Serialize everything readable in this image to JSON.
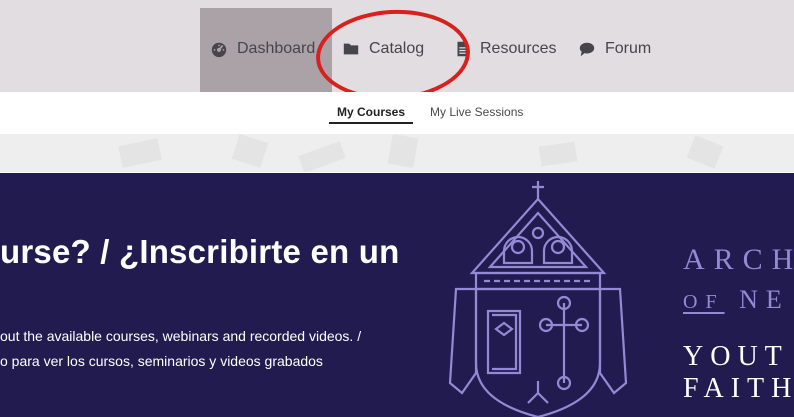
{
  "nav": {
    "items": [
      {
        "label": "Dashboard",
        "icon": "dashboard-gauge-icon",
        "active": true
      },
      {
        "label": "Catalog",
        "icon": "folder-icon",
        "active": false
      },
      {
        "label": "Resources",
        "icon": "document-icon",
        "active": false
      },
      {
        "label": "Forum",
        "icon": "speech-bubble-icon",
        "active": false
      }
    ],
    "annotation_color": "#d8211c"
  },
  "subtabs": {
    "items": [
      {
        "label": "My Courses",
        "active": true
      },
      {
        "label": "My Live Sessions",
        "active": false
      }
    ]
  },
  "banner": {
    "heading": "urse? / ¿Inscribirte en un",
    "line1": "out the available courses, webinars and recorded videos. /",
    "line2": "o para ver los cursos, seminarios y videos grabados",
    "brand": {
      "line1": "ARCH",
      "line2_prefix": "OF",
      "line2_rest": "NE",
      "line3": "YOUT",
      "line4": "FAITH"
    },
    "colors": {
      "background": "#221b4f",
      "crest": "#9389d4"
    }
  }
}
